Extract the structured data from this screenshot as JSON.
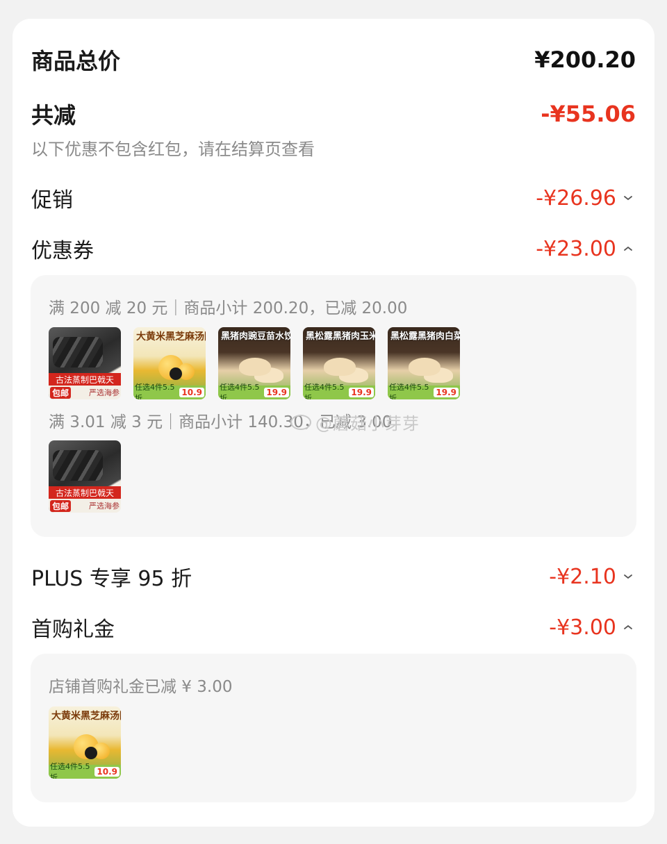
{
  "summary": {
    "total_label": "商品总价",
    "total_amount": "¥200.20",
    "discount_label": "共减",
    "discount_amount": "-¥55.06",
    "note": "以下优惠不包含红包，请在结算页查看"
  },
  "lines": {
    "promotion": {
      "label": "促销",
      "amount": "-¥26.96",
      "expanded": false
    },
    "coupon": {
      "label": "优惠券",
      "amount": "-¥23.00",
      "expanded": true
    },
    "plus": {
      "label": "PLUS 专享 95 折",
      "amount": "-¥2.10",
      "expanded": false
    },
    "first_purchase": {
      "label": "首购礼金",
      "amount": "-¥3.00",
      "expanded": true
    }
  },
  "coupon_panel": {
    "group1_text": "满 200 减 20 元｜商品小计 200.20，已减 20.00",
    "group2_text": "满 3.01 减 3 元｜商品小计 140.30，已减 3.00",
    "products": {
      "sea_cucumber": {
        "title": "古法蒸制巴戟天",
        "badge": "包邮",
        "sub": "严选海参",
        "icon": "sea-cucumber-image"
      },
      "tangyuan": {
        "title": "大黄米黑芝麻汤圆",
        "promo": "任选4件5.5折",
        "price": "10.9",
        "icon": "tangyuan-image"
      },
      "dumpling_pea": {
        "title": "黑猪肉豌豆苗水饺",
        "promo": "任选4件5.5折",
        "price": "19.9",
        "icon": "dumpling-image"
      },
      "dumpling_corn": {
        "title": "黑松露黑猪肉玉米水饺",
        "promo": "任选4件5.5折",
        "price": "19.9",
        "icon": "dumpling-image"
      },
      "dumpling_cabbage": {
        "title": "黑松露黑猪肉白菜水饺",
        "promo": "任选4件5.5折",
        "price": "19.9",
        "icon": "dumpling-image"
      }
    }
  },
  "first_purchase_panel": {
    "text": "店铺首购礼金已减 ¥ 3.00"
  },
  "watermark": {
    "text": "@蘑菇小芽芽",
    "icon": "weibo-icon"
  },
  "colors": {
    "accent": "#e8341f",
    "panel_bg": "#f6f6f6",
    "card_bg": "#ffffff",
    "page_bg": "#f2f2f2"
  }
}
